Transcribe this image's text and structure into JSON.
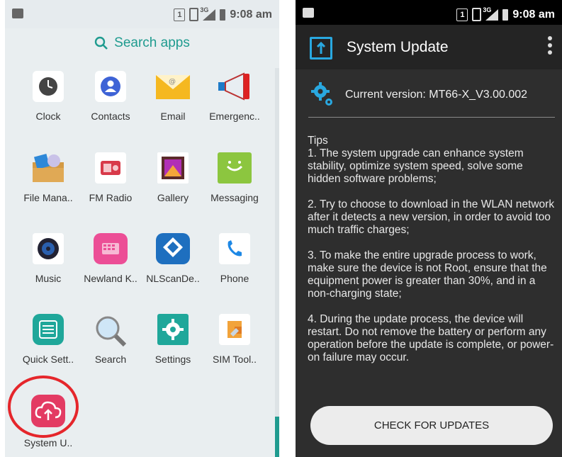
{
  "left": {
    "status": {
      "time": "9:08 am",
      "sim": "1",
      "net": "3G"
    },
    "search_label": "Search apps",
    "apps": [
      {
        "label": "Clock",
        "icon": "clock-icon"
      },
      {
        "label": "Contacts",
        "icon": "contacts-icon"
      },
      {
        "label": "Email",
        "icon": "email-icon"
      },
      {
        "label": "Emergenc..",
        "icon": "emergency-megaphone-icon"
      },
      {
        "label": "File Mana..",
        "icon": "file-manager-icon"
      },
      {
        "label": "FM Radio",
        "icon": "radio-icon"
      },
      {
        "label": "Gallery",
        "icon": "gallery-icon"
      },
      {
        "label": "Messaging",
        "icon": "messaging-icon"
      },
      {
        "label": "Music",
        "icon": "music-icon"
      },
      {
        "label": "Newland K..",
        "icon": "keyboard-icon"
      },
      {
        "label": "NLScanDe..",
        "icon": "nlscan-icon"
      },
      {
        "label": "Phone",
        "icon": "phone-icon"
      },
      {
        "label": "Quick Sett..",
        "icon": "quick-settings-icon"
      },
      {
        "label": "Search",
        "icon": "magnifier-icon"
      },
      {
        "label": "Settings",
        "icon": "gear-icon"
      },
      {
        "label": "SIM Tool..",
        "icon": "sim-toolkit-icon"
      },
      {
        "label": "System U..",
        "icon": "cloud-upload-icon"
      }
    ],
    "highlight_color": "#e5262b",
    "accent_color": "#1f9b8f"
  },
  "right": {
    "status": {
      "time": "9:08 am",
      "sim": "1",
      "net": "3G"
    },
    "title": "System Update",
    "current_version": "Current version: MT66-X_V3.00.002",
    "tips_heading": "Tips",
    "tips": [
      "1. The system upgrade can enhance system stability, optimize system speed, solve some hidden software problems;",
      "2. Try to choose to download in the WLAN network after it detects a new version, in order to avoid too much traffic charges;",
      "3. To make the entire upgrade process to work, make sure the device is not Root, ensure that the equipment power is greater than 30%, and in a non-charging state;",
      "4. During the update process, the device will restart. Do not remove the battery or perform any operation before the update is complete, or power-on failure may occur."
    ],
    "check_button": "CHECK FOR UPDATES"
  }
}
